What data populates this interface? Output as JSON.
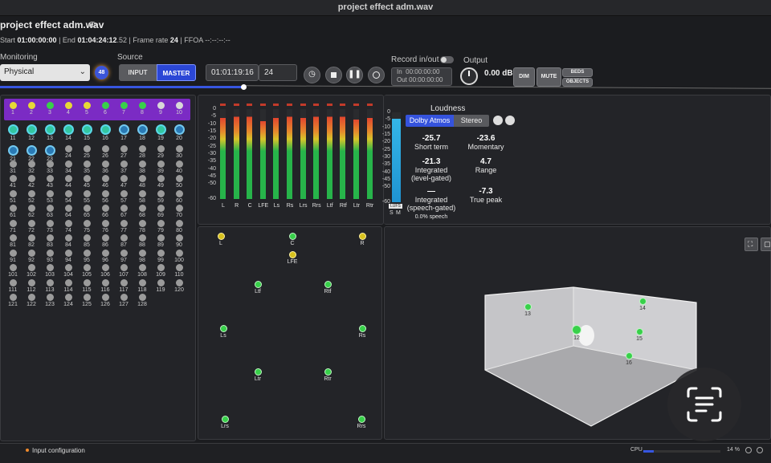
{
  "window": {
    "title": "project effect adm.wav"
  },
  "file": {
    "name": "project effect adm.wav",
    "start_label": "Start",
    "start": "01:00:00:00",
    "end_label": "End",
    "end": "01:04:24:12",
    "end_sub": ".52",
    "frame_rate_label": "Frame rate",
    "frame_rate": "24",
    "ffoa_label": "FFOA",
    "ffoa": "--:--:--:--"
  },
  "monitoring": {
    "label": "Monitoring",
    "selected": "Physical",
    "badge": "48"
  },
  "source": {
    "label": "Source",
    "input": "INPUT",
    "master": "MASTER"
  },
  "timecode": {
    "main": "01:01:19:16",
    "frames": "24"
  },
  "record": {
    "label": "Record in/out",
    "in_label": "In",
    "in": "00:00:00:00",
    "out_label": "Out",
    "out": "00:00:00:00"
  },
  "output": {
    "label": "Output",
    "gain": "0.00 dB",
    "dim": "DIM",
    "mute": "MUTE",
    "beds": "BEDS",
    "objects": "OBJECTS"
  },
  "playback": {
    "progress": 0.317
  },
  "channels": {
    "labels": [
      "1",
      "2",
      "3",
      "4",
      "5",
      "6",
      "7",
      "8",
      "9",
      "10",
      "11",
      "12",
      "13",
      "14",
      "15",
      "16",
      "17",
      "18",
      "19",
      "20",
      "21",
      "22",
      "23",
      "24",
      "25",
      "26",
      "27",
      "28",
      "29",
      "30",
      "31",
      "32",
      "33",
      "34",
      "35",
      "36",
      "37",
      "38",
      "39",
      "40",
      "41",
      "42",
      "43",
      "44",
      "45",
      "46",
      "47",
      "48",
      "49",
      "50",
      "51",
      "52",
      "53",
      "54",
      "55",
      "56",
      "57",
      "58",
      "59",
      "60",
      "61",
      "62",
      "63",
      "64",
      "65",
      "66",
      "67",
      "68",
      "69",
      "70",
      "71",
      "72",
      "73",
      "74",
      "75",
      "76",
      "77",
      "78",
      "79",
      "80",
      "81",
      "82",
      "83",
      "84",
      "85",
      "86",
      "87",
      "88",
      "89",
      "90",
      "91",
      "92",
      "93",
      "94",
      "95",
      "96",
      "97",
      "98",
      "99",
      "100",
      "101",
      "102",
      "103",
      "104",
      "105",
      "106",
      "107",
      "108",
      "109",
      "110",
      "111",
      "112",
      "113",
      "114",
      "115",
      "116",
      "117",
      "118",
      "119",
      "120",
      "121",
      "122",
      "123",
      "124",
      "125",
      "126",
      "127",
      "128"
    ]
  },
  "meters": {
    "scale": [
      "0",
      "-5",
      "-10",
      "-15",
      "-20",
      "-25",
      "-30",
      "-35",
      "-40",
      "-45",
      "-50",
      "-60"
    ],
    "channels": [
      "L",
      "R",
      "C",
      "LFE",
      "Ls",
      "Rs",
      "Lrs",
      "Rrs",
      "Ltf",
      "Rtf",
      "Ltr",
      "Rtr"
    ],
    "levels": [
      -6,
      -5,
      -5,
      -8,
      -6,
      -5,
      -6,
      -5,
      -5,
      -5,
      -7,
      -6
    ],
    "colors": {
      "red": "#e2452e",
      "orange": "#e58a2d",
      "yellow": "#d8c42a",
      "green": "#27b44a"
    }
  },
  "lufs_meter": {
    "scale": [
      "0",
      "-5",
      "-10",
      "-15",
      "-20",
      "-25",
      "-30",
      "-35",
      "-40",
      "-45",
      "-50",
      "-60"
    ],
    "label": "LUFS",
    "s_label": "S",
    "m_label": "M",
    "level_fraction": 0.93
  },
  "loudness": {
    "title": "Loudness",
    "tab_dolby": "Dolby Atmos",
    "tab_stereo": "Stereo",
    "short_term": {
      "value": "-25.7",
      "label": "Short term"
    },
    "momentary": {
      "value": "-23.6",
      "label": "Momentary"
    },
    "integrated": {
      "value": "-21.3",
      "label1": "Integrated",
      "label2": "(level-gated)"
    },
    "range": {
      "value": "4.7",
      "label": "Range"
    },
    "speech": {
      "value": "—",
      "label1": "Integrated",
      "label2": "(speech-gated)",
      "label3": "0.0% speech"
    },
    "true_peak": {
      "value": "-7.3",
      "label": "True peak"
    }
  },
  "speakers": [
    "L",
    "C",
    "R",
    "LFE",
    "Ltf",
    "Rtf",
    "Ls",
    "Rs",
    "Ltr",
    "Rtr",
    "Lrs",
    "Rrs"
  ],
  "room_objects": [
    "13",
    "14",
    "12",
    "15",
    "16"
  ],
  "status": {
    "input_config": "Input configuration",
    "cpu_label": "CPU",
    "cpu_pct": "14 %",
    "cpu_fraction": 0.14
  }
}
